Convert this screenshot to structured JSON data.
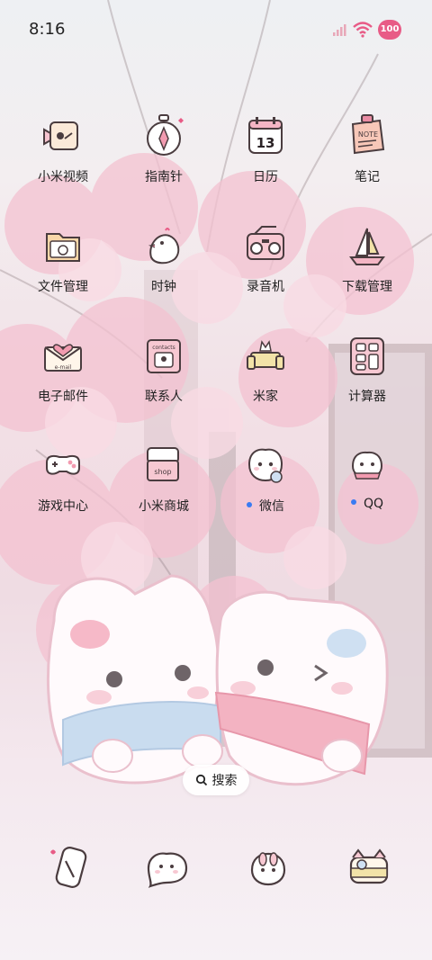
{
  "status_bar": {
    "time": "8:16",
    "battery": "100"
  },
  "apps": [
    {
      "label": "小米视频"
    },
    {
      "label": "指南针"
    },
    {
      "label": "日历",
      "icon_text": "13"
    },
    {
      "label": "笔记",
      "icon_text": "NOTE"
    },
    {
      "label": "文件管理"
    },
    {
      "label": "时钟"
    },
    {
      "label": "录音机"
    },
    {
      "label": "下载管理"
    },
    {
      "label": "电子邮件",
      "icon_text": "e-mail"
    },
    {
      "label": "联系人",
      "icon_text": "contacts"
    },
    {
      "label": "米家"
    },
    {
      "label": "计算器"
    },
    {
      "label": "游戏中心"
    },
    {
      "label": "小米商城",
      "icon_text": "shop"
    },
    {
      "label": "微信",
      "new_dot": true
    },
    {
      "label": "QQ",
      "new_dot": true
    }
  ],
  "search": {
    "label": "搜索"
  },
  "dock": [
    {
      "icon": "phone-icon"
    },
    {
      "icon": "messages-icon"
    },
    {
      "icon": "browser-icon"
    },
    {
      "icon": "camera-icon"
    }
  ],
  "colors": {
    "accent": "#e85b86",
    "dot": "#3a7bf2"
  }
}
